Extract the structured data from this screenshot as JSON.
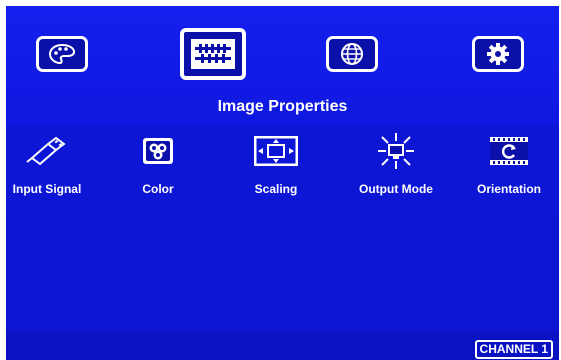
{
  "main_menu": {
    "items": [
      {
        "icon": "palette-icon"
      },
      {
        "icon": "image-properties-icon"
      },
      {
        "icon": "globe-icon"
      },
      {
        "icon": "gear-icon"
      }
    ],
    "selected_label": "Image Properties"
  },
  "submenu": {
    "items": [
      {
        "label": "Input Signal",
        "icon": "plug-icon"
      },
      {
        "label": "Color",
        "icon": "color-icon"
      },
      {
        "label": "Scaling",
        "icon": "scaling-icon"
      },
      {
        "label": "Output Mode",
        "icon": "display-burst-icon"
      },
      {
        "label": "Orientation",
        "icon": "rotation-icon"
      }
    ]
  },
  "status": {
    "channel": "CHANNEL 1"
  },
  "colors": {
    "background": "#0a14d8",
    "text": "#ffffff"
  }
}
